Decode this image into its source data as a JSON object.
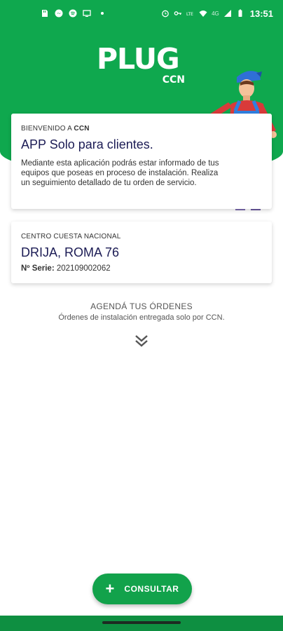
{
  "status_bar": {
    "time": "13:51",
    "network": "4G",
    "left_icons": [
      "sd-card-icon",
      "messenger-icon",
      "spotify-icon",
      "cast-icon"
    ],
    "right_icons": [
      "alarm-icon",
      "key-icon",
      "lte-icon",
      "wifi-icon",
      "signal-icon",
      "battery-icon"
    ]
  },
  "logo": {
    "main": "PLUG",
    "sub": "CCN"
  },
  "welcome_card": {
    "eyebrow_prefix": "BIENVENIDO A",
    "eyebrow_brand": "CCN",
    "title": "APP Solo para clientes.",
    "body": "Mediante esta aplicación podrás estar informado de tus equipos que poseas en proceso de instalación. Realiza un seguimiento detallado de tu orden de servicio."
  },
  "center_card": {
    "eyebrow": "CENTRO CUESTA NACIONAL",
    "title": "DRIJA, ROMA 76",
    "serial_label": "Nº Serie:",
    "serial_value": "202109002062"
  },
  "agenda": {
    "title": "AGENDÁ TUS ÓRDENES",
    "subtitle": "Órdenes de instalación entregada solo por CCN."
  },
  "fab": {
    "icon": "+",
    "label": "CONSULTAR"
  },
  "colors": {
    "brand_green": "#0fa84e",
    "title_navy": "#1c1c55"
  }
}
